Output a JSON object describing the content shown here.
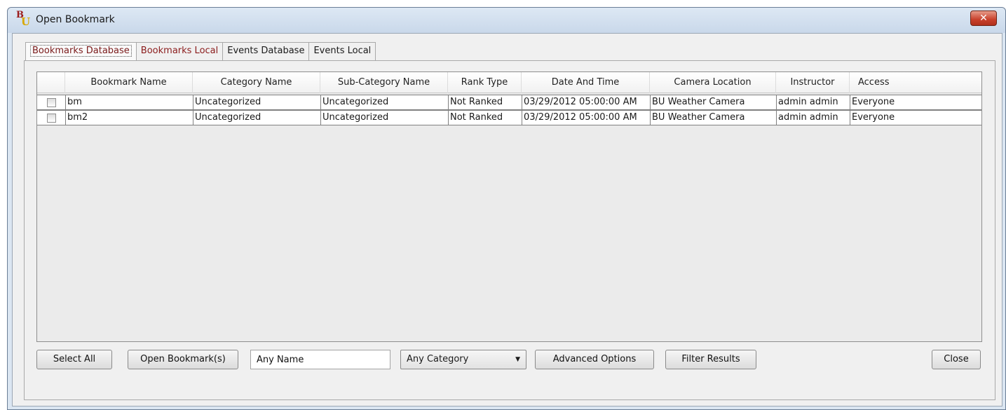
{
  "window": {
    "title": "Open Bookmark",
    "app_icon_letters": [
      "B",
      "U"
    ],
    "close_glyph": "✕"
  },
  "tabs": [
    {
      "label": "Bookmarks Database",
      "active": true
    },
    {
      "label": "Bookmarks Local",
      "active": false
    },
    {
      "label": "Events Database",
      "active": false
    },
    {
      "label": "Events Local",
      "active": false
    }
  ],
  "table": {
    "columns": [
      "",
      "Bookmark Name",
      "Category Name",
      "Sub-Category Name",
      "Rank Type",
      "Date And Time",
      "Camera Location",
      "Instructor",
      "Access"
    ],
    "rows": [
      {
        "checked": false,
        "name": "bm",
        "category": "Uncategorized",
        "subcategory": "Uncategorized",
        "rank": "Not Ranked",
        "datetime": "03/29/2012 05:00:00 AM",
        "camera": "BU Weather Camera",
        "instructor": "admin admin",
        "access": "Everyone"
      },
      {
        "checked": false,
        "name": "bm2",
        "category": "Uncategorized",
        "subcategory": "Uncategorized",
        "rank": "Not Ranked",
        "datetime": "03/29/2012 05:00:00 AM",
        "camera": "BU Weather Camera",
        "instructor": "admin admin",
        "access": "Everyone"
      }
    ]
  },
  "controls": {
    "select_all": "Select All",
    "open_bookmarks": "Open Bookmark(s)",
    "name_filter_value": "Any Name",
    "category_select": "Any Category",
    "advanced_options": "Advanced Options",
    "filter_results": "Filter Results",
    "close": "Close"
  },
  "colors": {
    "active_tab_text": "#7a1a1a",
    "close_button": "#c8402b",
    "titlebar": "#c9d8ea"
  }
}
